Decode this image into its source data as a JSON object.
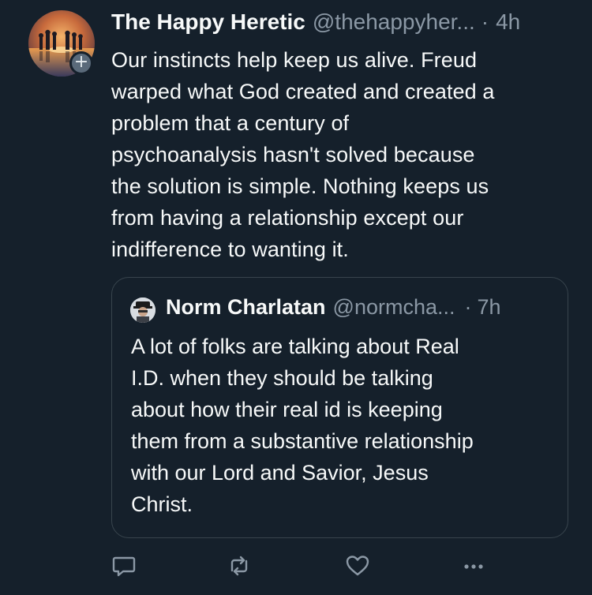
{
  "tweet": {
    "display_name": "The Happy Heretic",
    "handle": "@thehappyher...",
    "separator": "·",
    "time": "4h",
    "follow_symbol": "+",
    "body_lines": [
      "Our instincts help keep us alive. Freud",
      "warped what God created and created a",
      "problem that a century of",
      "psychoanalysis hasn't solved because",
      "the solution is simple. Nothing keeps us",
      "from having a relationship except our",
      "indifference to wanting it."
    ]
  },
  "quote": {
    "display_name": "Norm Charlatan",
    "handle": "@normcha...",
    "separator": "·",
    "time": "7h",
    "body_lines": [
      "A lot of folks are talking about Real",
      "I.D. when they should be talking",
      "about how their real id is keeping",
      "them from a substantive relationship",
      "with our Lord and Savior, Jesus",
      "Christ."
    ]
  },
  "actions": {
    "icons": [
      "reply-icon",
      "retweet-icon",
      "like-icon",
      "more-icon"
    ],
    "icon_color": "#8b98a5"
  },
  "colors": {
    "background": "#15202b",
    "text": "#f7f9f9",
    "secondary_text": "#8b98a5",
    "border": "#38444d"
  }
}
